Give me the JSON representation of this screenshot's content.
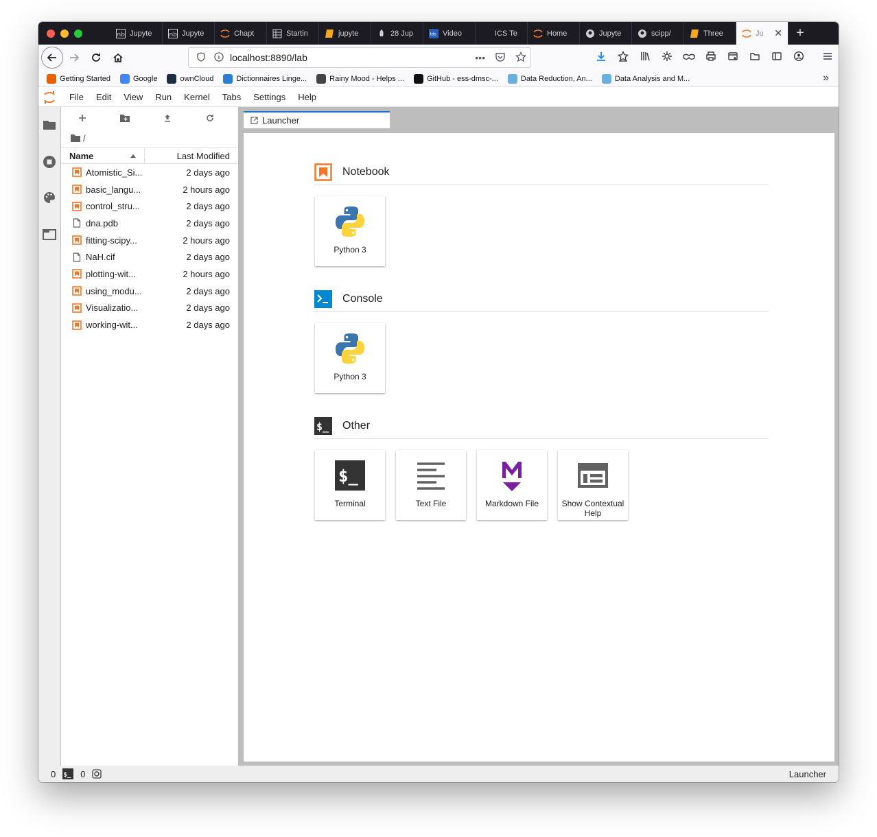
{
  "browser": {
    "tabs": [
      {
        "label": "Jupyte",
        "icon": "nb-icon"
      },
      {
        "label": "Jupyte",
        "icon": "nb-icon"
      },
      {
        "label": "Chapt",
        "icon": "jupyter-icon"
      },
      {
        "label": "Startin",
        "icon": "grid-icon"
      },
      {
        "label": "jupyte",
        "icon": "book-icon"
      },
      {
        "label": "28 Jup",
        "icon": "rocket-icon"
      },
      {
        "label": "Video",
        "icon": "tds-icon"
      },
      {
        "label": "ICS Te",
        "icon": "blank-icon"
      },
      {
        "label": "Home",
        "icon": "jupyter-icon"
      },
      {
        "label": "Jupyte",
        "icon": "github-icon"
      },
      {
        "label": "scipp/",
        "icon": "github-icon"
      },
      {
        "label": "Three",
        "icon": "book-icon"
      },
      {
        "label": "Ju",
        "icon": "jupyter-icon",
        "active": true
      }
    ],
    "new_tab_label": "+",
    "url": "localhost:8890/lab",
    "bookmarks": [
      {
        "label": "Getting Started",
        "icon": "firefox-icon",
        "color": "#e66000"
      },
      {
        "label": "Google",
        "icon": "google-icon",
        "color": "#4285f4"
      },
      {
        "label": "ownCloud",
        "icon": "cloud-icon",
        "color": "#1d2d44"
      },
      {
        "label": "Dictionnaires Linge...",
        "icon": "dict-icon",
        "color": "#2a7fd4"
      },
      {
        "label": "Rainy Mood - Helps ...",
        "icon": "drop-icon",
        "color": "#444"
      },
      {
        "label": "GitHub - ess-dmsc-...",
        "icon": "github-icon",
        "color": "#111"
      },
      {
        "label": "Data Reduction, An...",
        "icon": "ess-icon",
        "color": "#6ab0de"
      },
      {
        "label": "Data Analysis and M...",
        "icon": "ess-icon",
        "color": "#6ab0de"
      }
    ]
  },
  "jupyter": {
    "menu": [
      "File",
      "Edit",
      "View",
      "Run",
      "Kernel",
      "Tabs",
      "Settings",
      "Help"
    ],
    "breadcrumb": "/",
    "columns": {
      "name": "Name",
      "modified": "Last Modified"
    },
    "files": [
      {
        "name": "Atomistic_Si...",
        "modified": "2 days ago",
        "type": "notebook"
      },
      {
        "name": "basic_langu...",
        "modified": "2 hours ago",
        "type": "notebook"
      },
      {
        "name": "control_stru...",
        "modified": "2 days ago",
        "type": "notebook"
      },
      {
        "name": "dna.pdb",
        "modified": "2 days ago",
        "type": "file"
      },
      {
        "name": "fitting-scipy...",
        "modified": "2 hours ago",
        "type": "notebook"
      },
      {
        "name": "NaH.cif",
        "modified": "2 days ago",
        "type": "file"
      },
      {
        "name": "plotting-wit...",
        "modified": "2 hours ago",
        "type": "notebook"
      },
      {
        "name": "using_modu...",
        "modified": "2 days ago",
        "type": "notebook"
      },
      {
        "name": "Visualizatio...",
        "modified": "2 days ago",
        "type": "notebook"
      },
      {
        "name": "working-wit...",
        "modified": "2 days ago",
        "type": "notebook"
      }
    ],
    "main_tab": "Launcher",
    "launcher": {
      "notebook": {
        "title": "Notebook",
        "cards": [
          {
            "label": "Python 3"
          }
        ]
      },
      "console": {
        "title": "Console",
        "cards": [
          {
            "label": "Python 3"
          }
        ]
      },
      "other": {
        "title": "Other",
        "cards": [
          {
            "label": "Terminal"
          },
          {
            "label": "Text File"
          },
          {
            "label": "Markdown File"
          },
          {
            "label": "Show Contextual Help"
          }
        ]
      }
    },
    "status": {
      "terminals": "0",
      "kernels": "0",
      "right": "Launcher"
    }
  },
  "colors": {
    "notebook_orange": "#f37726",
    "console_blue": "#0288d1",
    "accent": "#1976d2",
    "markdown_purple": "#7b1fa2"
  }
}
